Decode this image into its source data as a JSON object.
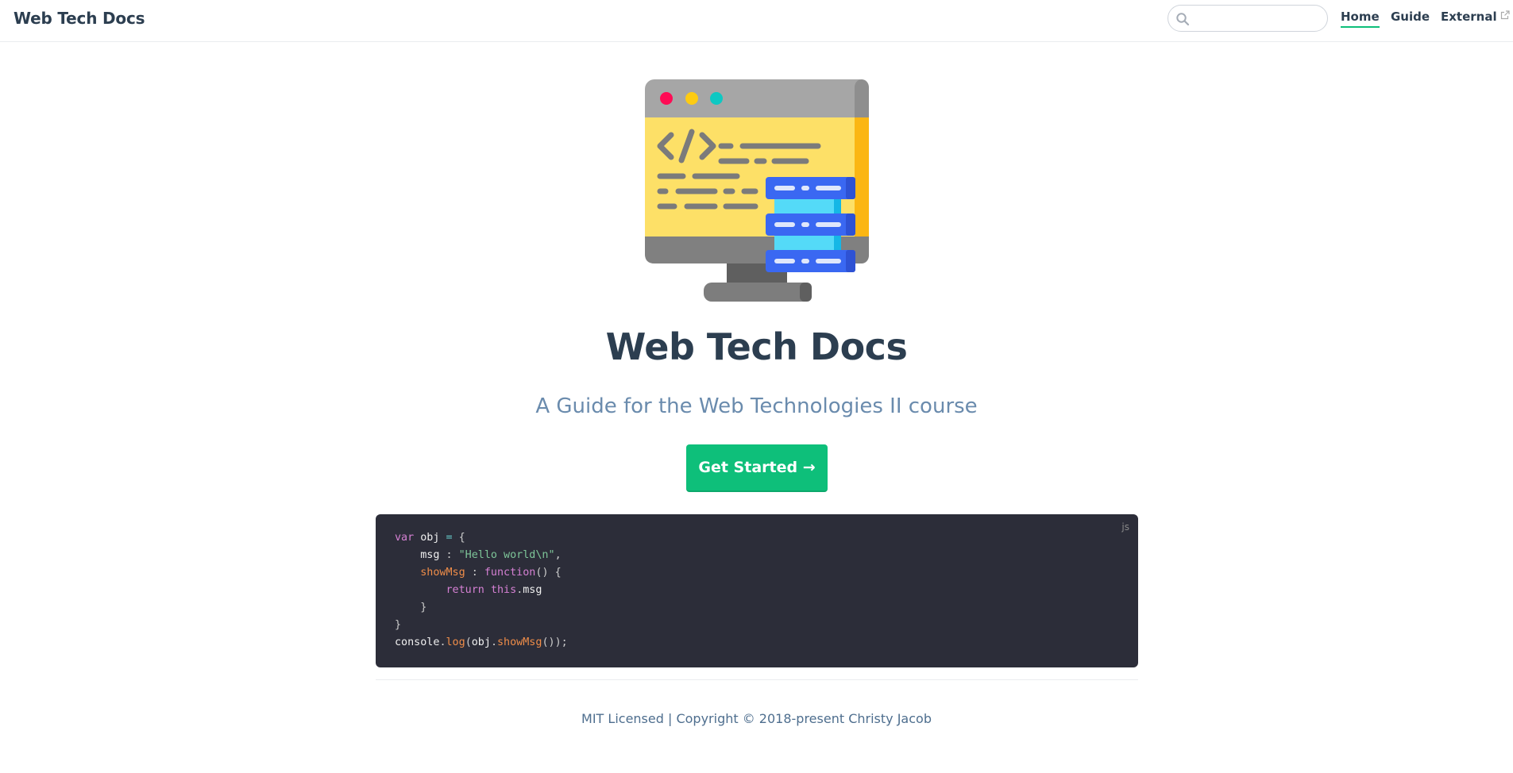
{
  "navbar": {
    "site_name": "Web Tech Docs",
    "search": {
      "value": "",
      "placeholder": ""
    },
    "links": [
      {
        "label": "Home",
        "active": true
      },
      {
        "label": "Guide",
        "active": false
      },
      {
        "label": "External",
        "active": false,
        "icon": "external-link-icon"
      }
    ]
  },
  "hero": {
    "image_icon": "monitor-code-illustration",
    "title": "Web Tech Docs",
    "description": "A Guide for the Web Technologies II course",
    "action_label": "Get Started →"
  },
  "code_sample": {
    "language": "js",
    "lines": [
      "var obj = {",
      "    msg : \"Hello world\\n\",",
      "    showMsg : function() {",
      "        return this.msg",
      "    }",
      "}",
      "console.log(obj.showMsg());"
    ]
  },
  "footer": {
    "text": "MIT Licensed | Copyright © 2018-present Christy Jacob"
  },
  "colors": {
    "accent": "#0ebf7a",
    "text": "#2c3e50",
    "description": "#6a8bad",
    "code_bg": "#2c2d39"
  }
}
